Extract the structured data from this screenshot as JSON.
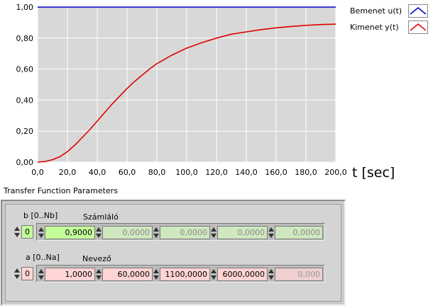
{
  "chart_data": {
    "type": "line",
    "x_ticks": [
      "0,0",
      "20,0",
      "40,0",
      "60,0",
      "80,0",
      "100,0",
      "120,0",
      "140,0",
      "160,0",
      "180,0",
      "200,0"
    ],
    "y_ticks": [
      "0,00",
      "0,20",
      "0,40",
      "0,60",
      "0,80",
      "1,00"
    ],
    "xlim": [
      0,
      200
    ],
    "ylim": [
      0,
      1
    ],
    "xlabel": "t [sec]",
    "grid": true,
    "legend_position": "right",
    "series": [
      {
        "name": "Bemenet u(t)",
        "color": "#0000c8",
        "x": [
          0,
          200
        ],
        "y": [
          1.0,
          1.0
        ]
      },
      {
        "name": "Kimenet y(t)",
        "color": "#e00000",
        "x": [
          0,
          5,
          10,
          15,
          20,
          25,
          30,
          35,
          40,
          45,
          50,
          55,
          60,
          65,
          70,
          75,
          80,
          90,
          100,
          110,
          120,
          130,
          140,
          150,
          160,
          170,
          180,
          190,
          200
        ],
        "y": [
          0.0,
          0.004,
          0.016,
          0.035,
          0.068,
          0.11,
          0.16,
          0.21,
          0.265,
          0.32,
          0.375,
          0.425,
          0.475,
          0.52,
          0.56,
          0.6,
          0.635,
          0.69,
          0.735,
          0.77,
          0.8,
          0.825,
          0.84,
          0.855,
          0.866,
          0.875,
          0.882,
          0.887,
          0.89
        ]
      }
    ]
  },
  "legend": {
    "items": [
      {
        "label": "Bemenet u(t)",
        "color": "#0000c8"
      },
      {
        "label": "Kimenet y(t)",
        "color": "#e00000"
      }
    ]
  },
  "panel": {
    "title": "Transfer Function Parameters",
    "b": {
      "index_label": "b [0..Nb]",
      "array_label": "Számláló",
      "index": "0",
      "values": [
        "0,9000",
        "0,0000",
        "0,0000",
        "0,0000",
        "0,0000"
      ]
    },
    "a": {
      "index_label": "a [0..Na]",
      "array_label": "Nevező",
      "index": "0",
      "values": [
        "1,0000",
        "60,0000",
        "1100,0000",
        "6000,0000",
        "0,000"
      ]
    }
  }
}
